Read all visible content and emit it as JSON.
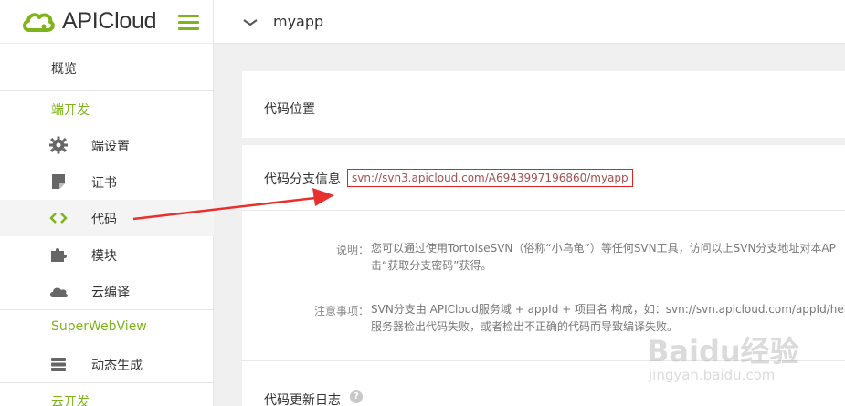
{
  "brand": {
    "name": "APICloud",
    "accent": "#7fb31b"
  },
  "topbar": {
    "app_name": "myapp"
  },
  "sidebar": {
    "overview": "概览",
    "section_client": "端开发",
    "items": [
      {
        "label": "端设置",
        "icon": "gear-icon"
      },
      {
        "label": "证书",
        "icon": "certificate-icon"
      },
      {
        "label": "代码",
        "icon": "code-icon"
      },
      {
        "label": "模块",
        "icon": "puzzle-icon"
      },
      {
        "label": "云编译",
        "icon": "cloud-icon"
      }
    ],
    "section_superwebview": "SuperWebView",
    "dynamic_label": "动态生成",
    "section_cloud": "云开发"
  },
  "content": {
    "code_location_title": "代码位置",
    "branch_info_label": "代码分支信息",
    "svn_url": "svn://svn3.apicloud.com/A6943997196860/myapp",
    "note_label": "说明：",
    "note_line1": "您可以通过使用TortoiseSVN（俗称“小乌龟”）等任何SVN工具，访问以上SVN分支地址对本AP",
    "note_line2": "击“获取分支密码”获得。",
    "caution_label": "注意事项：",
    "caution_line1": "SVN分支由 APICloud服务域 + appId + 项目名 构成，如：svn://svn.apicloud.com/appId/hello",
    "caution_line2": "服务器检出代码失败，或者检出不正确的代码而导致编译失败。",
    "update_log_title": "代码更新日志",
    "help_glyph": "?"
  },
  "watermark": {
    "text": "Baidu经验",
    "sub": "jingyan.baidu.com"
  }
}
